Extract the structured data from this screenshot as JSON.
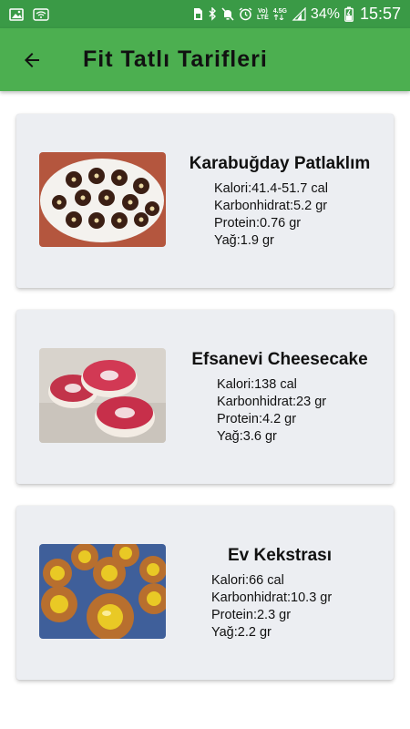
{
  "status_bar": {
    "network_label_top": "Vo)",
    "network_label_bottom": "LTE",
    "network_gen": "4.5G",
    "battery": "34%",
    "time": "15:57"
  },
  "app_bar": {
    "title": "Fit Tatlı Tarifleri"
  },
  "recipes": [
    {
      "title": "Karabuğday Patlaklım",
      "calories": "Kalori:41.4-51.7 cal",
      "carbs": "Karbonhidrat:5.2 gr",
      "protein": "Protein:0.76 gr",
      "fat": "Yağ:1.9 gr"
    },
    {
      "title": "Efsanevi Cheesecake",
      "calories": "Kalori:138 cal",
      "carbs": "Karbonhidrat:23 gr",
      "protein": "Protein:4.2 gr",
      "fat": "Yağ:3.6 gr"
    },
    {
      "title": "Ev Kekstrası",
      "calories": "Kalori:66 cal",
      "carbs": "Karbonhidrat:10.3 gr",
      "protein": "Protein:2.3 gr",
      "fat": "Yağ:2.2 gr"
    }
  ],
  "colors": {
    "status_bar": "#3a9a46",
    "app_bar": "#4caf50",
    "card_bg": "#eceef2"
  }
}
